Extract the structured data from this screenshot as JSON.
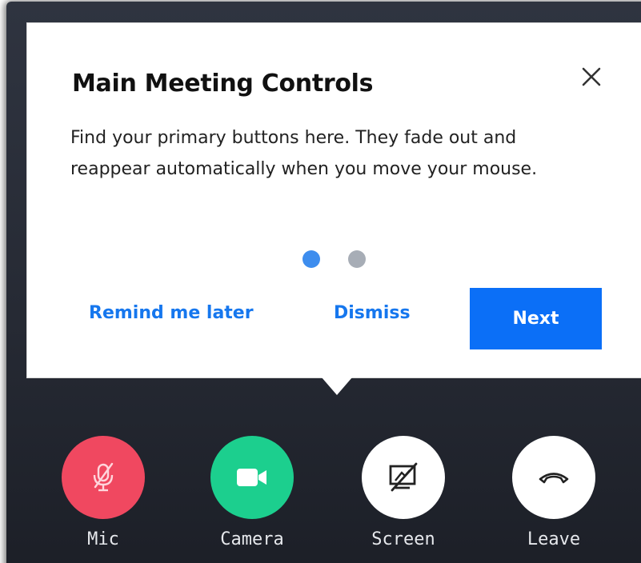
{
  "tooltip": {
    "title": "Main Meeting Controls",
    "body": "Find your primary buttons here. They fade out and reappear automatically when you move your mouse.",
    "close_icon": "close-icon",
    "steps_total": 2,
    "step_current": 1,
    "remind_label": "Remind me later",
    "dismiss_label": "Dismiss",
    "next_label": "Next"
  },
  "controls": [
    {
      "label": "Mic",
      "icon": "mic-muted-icon",
      "color": "#f04860"
    },
    {
      "label": "Camera",
      "icon": "video-camera-icon",
      "color": "#1ccf8e"
    },
    {
      "label": "Screen",
      "icon": "screen-share-off-icon",
      "color": "#ffffff"
    },
    {
      "label": "Leave",
      "icon": "hang-up-icon",
      "color": "#ffffff"
    }
  ],
  "colors": {
    "accent": "#0b6ff7",
    "link": "#1677ee",
    "dot_active": "#3d8dee",
    "dot_inactive": "#a7adb6",
    "background": "#262a34"
  }
}
